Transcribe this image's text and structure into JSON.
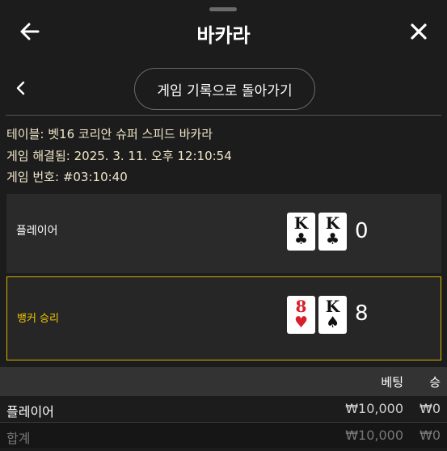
{
  "header": {
    "title": "바카라",
    "back_icon": "arrow-left-icon",
    "close_icon": "close-icon"
  },
  "subnav": {
    "back_icon": "chevron-left-icon",
    "history_button": "게임 기록으로 돌아가기"
  },
  "info": {
    "table_label": "테이블:",
    "table_value": "벳16 코리안 슈퍼 스피드 바카라",
    "resolved_label": "게임 해결됨:",
    "resolved_value": "2025. 3. 11. 오후 12:10:54",
    "game_no_label": "게임 번호:",
    "game_no_value": "#03:10:40"
  },
  "hands": {
    "player": {
      "label": "플레이어",
      "score": "0",
      "cards": [
        {
          "rank": "K",
          "suit": "♣"
        },
        {
          "rank": "K",
          "suit": "♣"
        }
      ]
    },
    "banker": {
      "label": "뱅커 승리",
      "score": "8",
      "cards": [
        {
          "rank": "8",
          "suit": "♥"
        },
        {
          "rank": "K",
          "suit": "♠"
        }
      ]
    }
  },
  "bets_table": {
    "headers": {
      "bet": "베팅",
      "win": "승"
    },
    "rows": [
      {
        "name": "플레이어",
        "bet": "₩10,000",
        "win": "₩0"
      }
    ],
    "total": {
      "name": "합계",
      "bet": "₩10,000",
      "win": "₩0"
    }
  },
  "colors": {
    "background": "#1c1c1c",
    "panel": "#2a2a2a",
    "accent": "#d4b200",
    "info_text": "#f0e6c8",
    "card_red": "#d8202a"
  }
}
